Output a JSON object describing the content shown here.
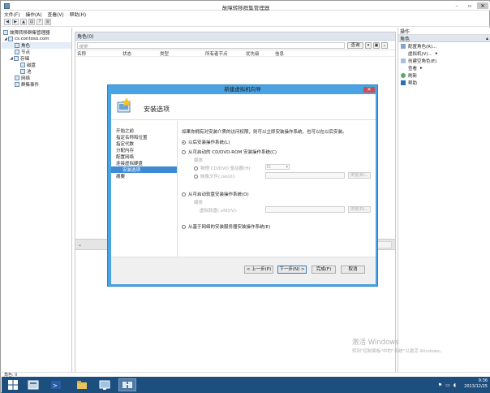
{
  "window": {
    "title": "故障转移群集管理器"
  },
  "menu": [
    "文件(F)",
    "操作(A)",
    "查看(V)",
    "帮助(H)"
  ],
  "tree": [
    {
      "label": "故障转移群集管理器",
      "icon": "cluster-manager-icon",
      "indent": 0
    },
    {
      "label": "cs.contoso.com",
      "icon": "cluster-icon",
      "indent": 1
    },
    {
      "label": "角色",
      "icon": "roles-icon",
      "indent": 2
    },
    {
      "label": "节点",
      "icon": "nodes-icon",
      "indent": 2
    },
    {
      "label": "存储",
      "icon": "storage-icon",
      "indent": 2
    },
    {
      "label": "磁盘",
      "icon": "disk-icon",
      "indent": 3
    },
    {
      "label": "池",
      "icon": "pool-icon",
      "indent": 3
    },
    {
      "label": "网络",
      "icon": "network-icon",
      "indent": 2
    },
    {
      "label": "群集事件",
      "icon": "events-icon",
      "indent": 2
    }
  ],
  "roles": {
    "header": "角色(0)",
    "search_placeholder": "搜索",
    "query_label": "查询",
    "columns": [
      "名称",
      "状态",
      "类型",
      "所有者节点",
      "优先级",
      "信息"
    ]
  },
  "actions": {
    "header": "操作",
    "section": "角色",
    "items": [
      {
        "label": "配置角色(R)...",
        "icon": "configure-role-icon"
      },
      {
        "label": "虚拟机(V)...",
        "icon": "virtual-machine-icon"
      },
      {
        "label": "创建空角色(E)",
        "icon": "empty-role-icon"
      },
      {
        "label": "查看",
        "icon": "view-icon"
      },
      {
        "label": "刷新",
        "icon": "refresh-icon"
      },
      {
        "label": "帮助",
        "icon": "help-icon"
      }
    ]
  },
  "wizard": {
    "title": "新建虚拟机向导",
    "page_title": "安装选项",
    "steps": [
      {
        "label": "开始之前",
        "sub": false,
        "active": false
      },
      {
        "label": "指定名称和位置",
        "sub": false,
        "active": false
      },
      {
        "label": "指定代数",
        "sub": false,
        "active": false
      },
      {
        "label": "分配内存",
        "sub": false,
        "active": false
      },
      {
        "label": "配置网络",
        "sub": false,
        "active": false
      },
      {
        "label": "连接虚拟硬盘",
        "sub": false,
        "active": false
      },
      {
        "label": "安装选项",
        "sub": true,
        "active": true
      },
      {
        "label": "摘要",
        "sub": false,
        "active": false
      }
    ],
    "intro": "如果你拥有对安装介质的访问权限，则可以立即安装操作系统，也可以在以后安装。",
    "options": {
      "later": "以后安装操作系统(L)",
      "cd_dvd": "从可启动的 CD/DVD-ROM 安装操作系统(C)",
      "media_label": "媒体",
      "physical_drive": "物理 CD/DVD 驱动器(H):",
      "drive_value": "D:",
      "image_file": "映像文件(.iso)(I):",
      "browse": "浏览(B)...",
      "floppy": "从可启动软盘安装操作系统(O)",
      "floppy_media": "媒体",
      "virtual_floppy": "虚拟软盘(.vfd)(V):",
      "browse2": "浏览(R)...",
      "network": "从基于网络的安装服务器安装操作系统(E)"
    },
    "buttons": {
      "prev": "< 上一步(P)",
      "next": "下一步(N) >",
      "finish": "完成(F)",
      "cancel": "取消"
    }
  },
  "statusbar": {
    "text": "角色: 0"
  },
  "watermark": {
    "line1": "激活 Windows",
    "line2": "转到\"控制面板\"中的\"系统\"以激活 Windows。"
  },
  "taskbar": {
    "time": "9:36",
    "date": "2013/12/25"
  },
  "colors": {
    "accent": "#4aa3e3",
    "taskbar": "#1d4f7e",
    "selection": "#3f8bd3"
  }
}
